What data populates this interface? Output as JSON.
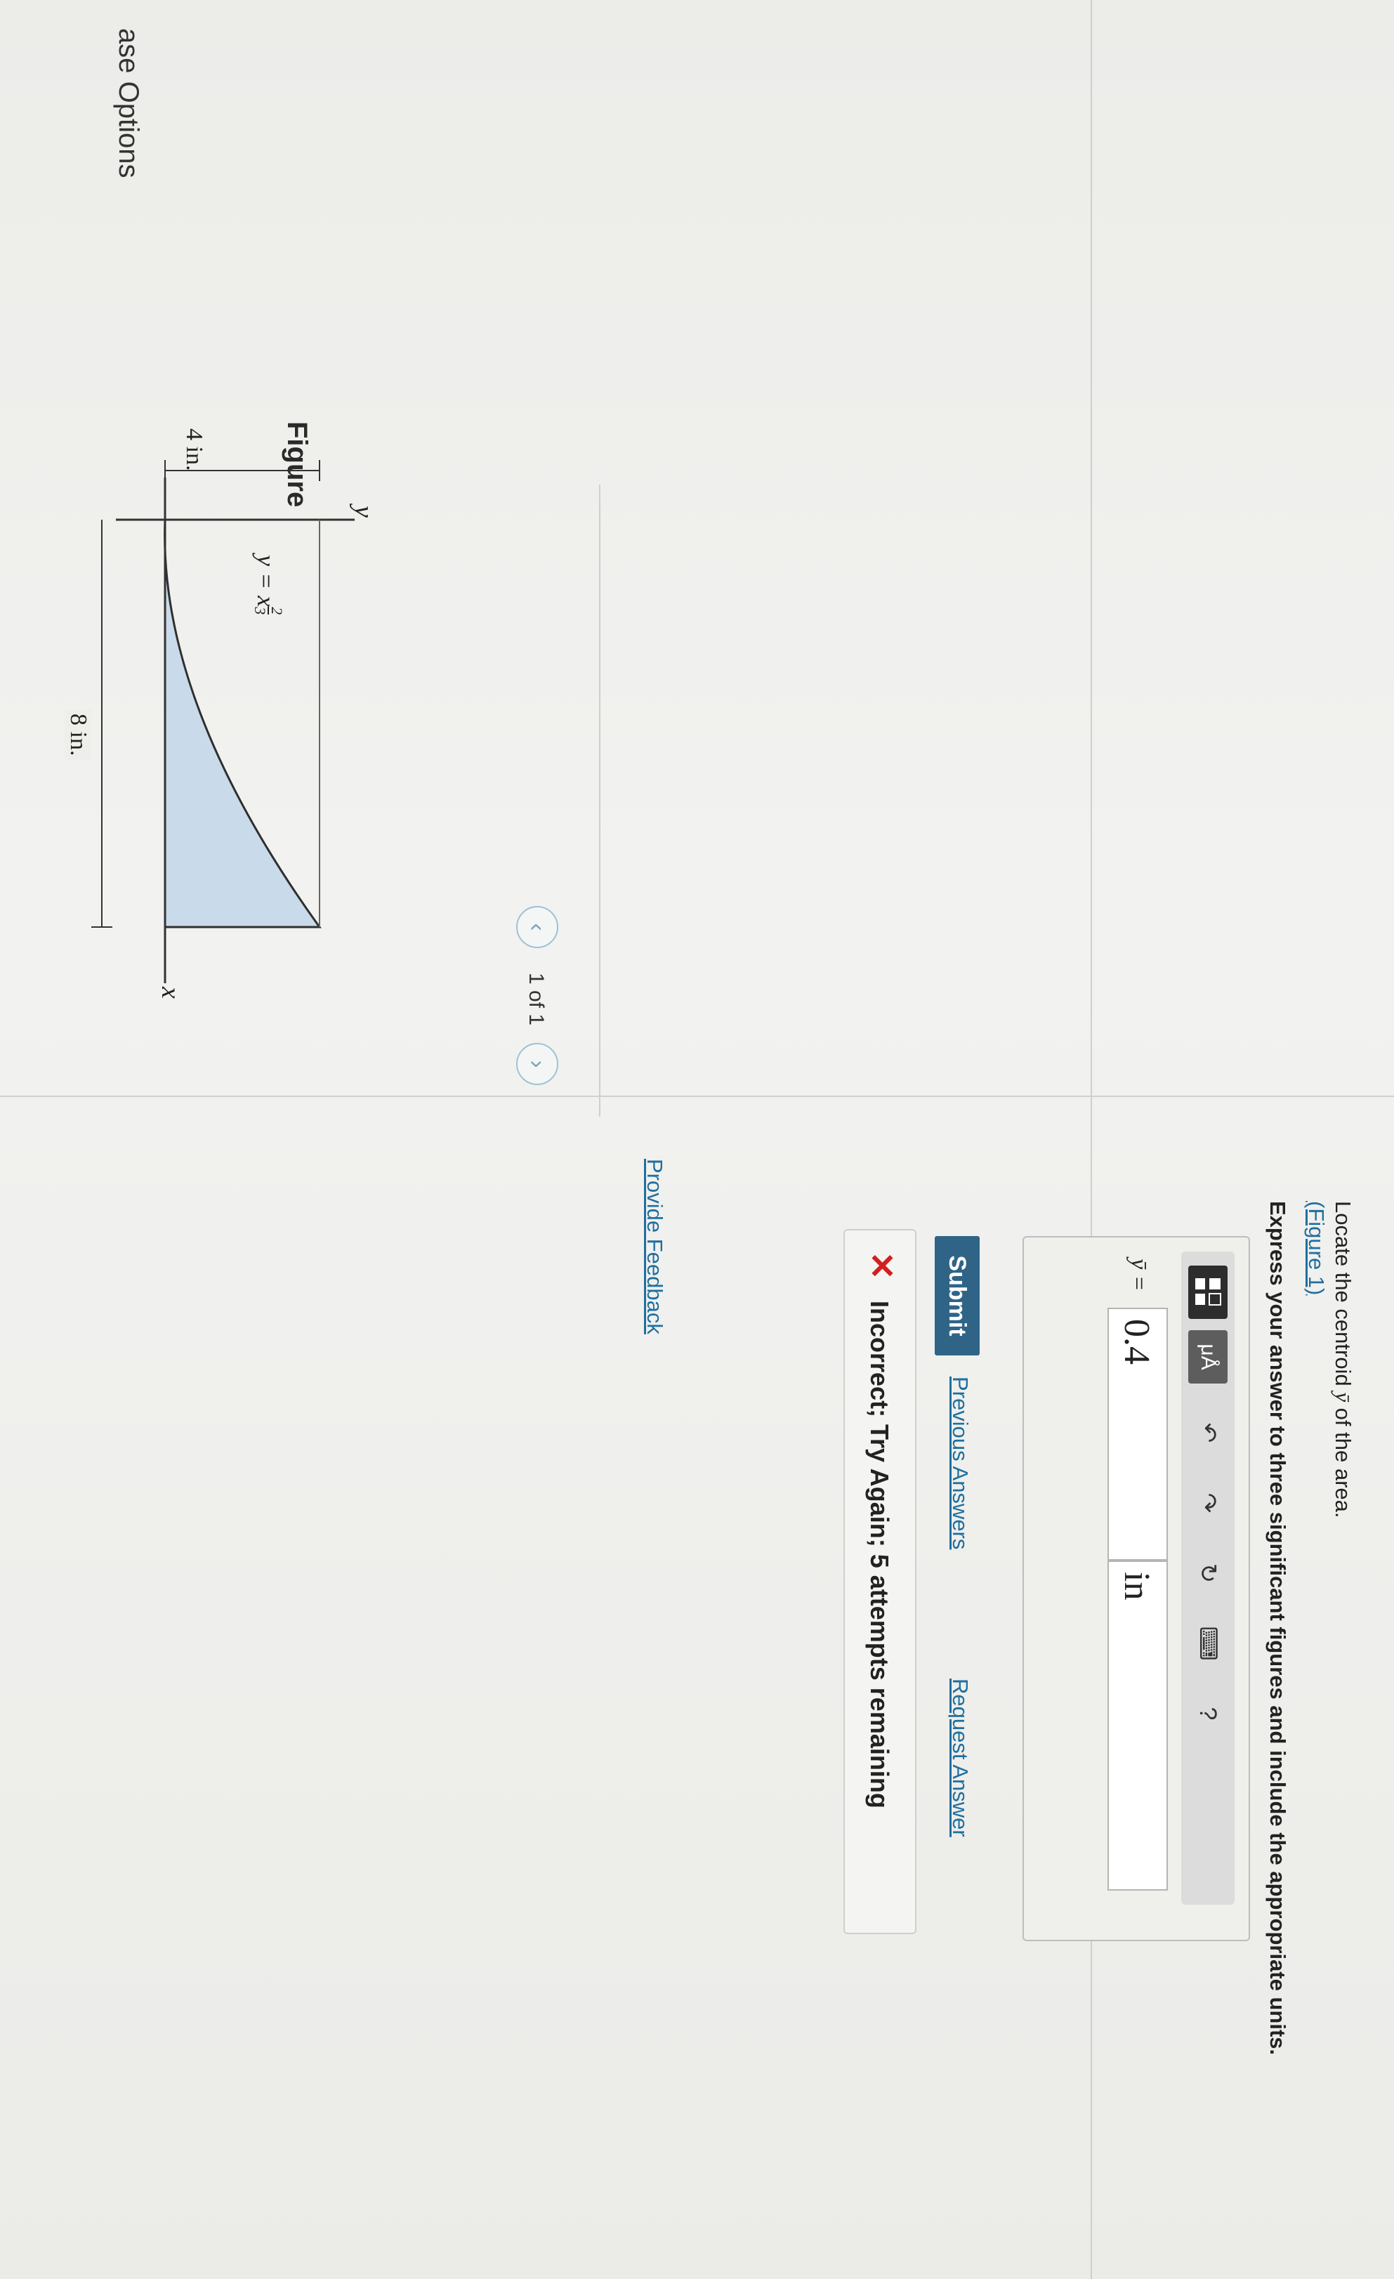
{
  "sidebar": {
    "options_label": "ase Options"
  },
  "figure": {
    "title": "Figure",
    "pagination": "1 of 1",
    "curve_label": "y = x",
    "curve_exp_num": "2",
    "curve_exp_den": "3",
    "axis_y": "y",
    "axis_x": "x",
    "dim_height": "4 in.",
    "dim_width": "8 in."
  },
  "question": {
    "prompt_prefix": "Locate the centroid ",
    "prompt_symbol": "ȳ",
    "prompt_suffix": " of the area.",
    "figure_link": "(Figure 1)",
    "instruction": "Express your answer to three significant figures and include the appropriate units."
  },
  "answer": {
    "label": "ȳ =",
    "value": "0.4",
    "unit": "in"
  },
  "toolbar": {
    "icons": [
      "templates-icon",
      "units-icon",
      "undo-icon",
      "redo-icon",
      "reset-icon",
      "keyboard-icon",
      "help-icon"
    ],
    "units_glyph": "μÅ",
    "help_glyph": "?"
  },
  "actions": {
    "submit": "Submit",
    "previous": "Previous Answers",
    "request": "Request Answer"
  },
  "feedback": {
    "message": "Incorrect; Try Again; 5 attempts remaining"
  },
  "footer": {
    "provide_feedback": "Provide Feedback"
  },
  "colors": {
    "accent": "#2f6487",
    "link": "#1f6f9f",
    "error": "#d0201f",
    "shape_fill": "#c9daea"
  }
}
